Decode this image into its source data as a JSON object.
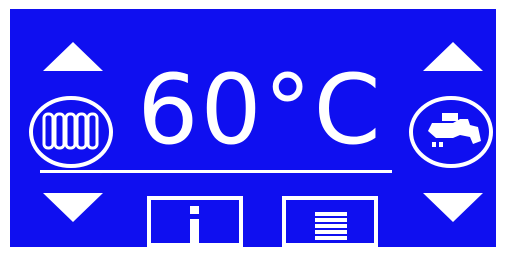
{
  "display": {
    "temperature": "60°C",
    "background_color": "#0f0ff0",
    "foreground_color": "#ffffff"
  },
  "controls": {
    "left_up_arrow_icon": "triangle-up-icon",
    "left_down_arrow_icon": "triangle-down-icon",
    "right_up_arrow_icon": "triangle-up-icon",
    "right_down_arrow_icon": "triangle-down-icon",
    "info_button_icon": "info-icon",
    "menu_button_icon": "menu-lines-icon",
    "left_mode_icon": "radiator-icon",
    "right_mode_icon": "tap-faucet-icon"
  }
}
